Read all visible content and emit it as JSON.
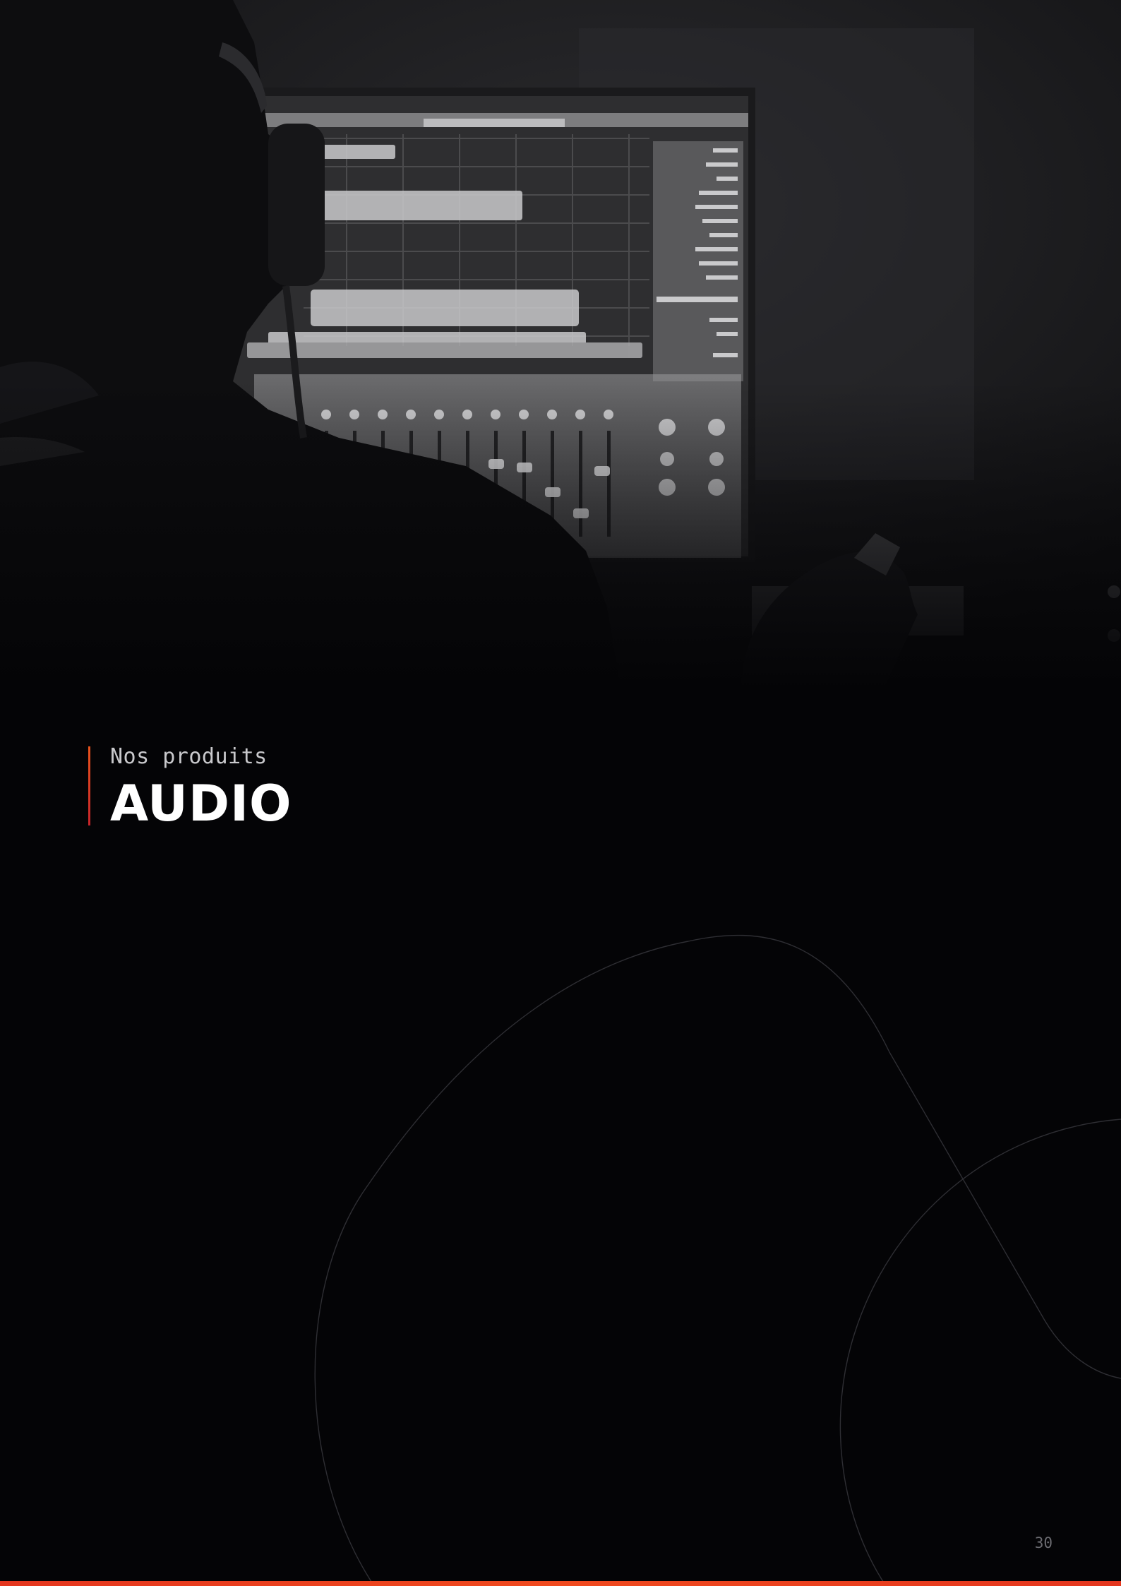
{
  "section": {
    "kicker": "Nos produits",
    "title": "AUDIO"
  },
  "hero_image": {
    "subject": "photo-studio-engineer-at-monitor"
  },
  "footer": {
    "page_number": "30"
  },
  "colors": {
    "background": "#040406",
    "accent_gradient_start": "#e8531c",
    "accent_gradient_end": "#c8242a",
    "bottom_bar": "#f04a1e",
    "title": "#ffffff",
    "kicker": "#c9c9cc",
    "page_number": "#6b6b70"
  }
}
